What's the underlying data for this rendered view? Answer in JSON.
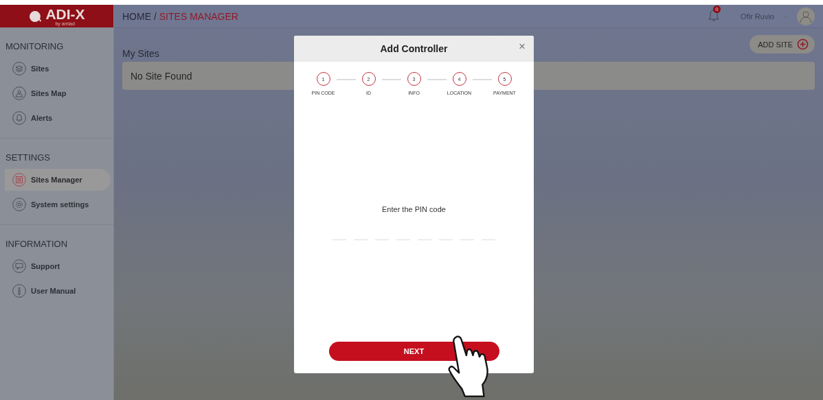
{
  "logo": {
    "name": "ADI-X",
    "tagline": "by amiad"
  },
  "breadcrumb": {
    "home": "HOME /",
    "current": "SITES MANAGER"
  },
  "header": {
    "notifications": "0",
    "user": "Ofir Ruvio"
  },
  "sidebar": {
    "sections": [
      {
        "title": "MONITORING",
        "items": [
          {
            "label": "Sites",
            "kind": "layers",
            "selected": false
          },
          {
            "label": "Sites Map",
            "kind": "map",
            "selected": false
          },
          {
            "label": "Alerts",
            "kind": "bell",
            "selected": false
          }
        ]
      },
      {
        "title": "SETTINGS",
        "items": [
          {
            "label": "Sites Manager",
            "kind": "sliders",
            "selected": true
          },
          {
            "label": "System settings",
            "kind": "gear",
            "selected": false
          }
        ]
      },
      {
        "title": "INFORMATION",
        "items": [
          {
            "label": "Support",
            "kind": "chat",
            "selected": false
          },
          {
            "label": "User Manual",
            "kind": "info",
            "selected": false
          }
        ]
      }
    ]
  },
  "main": {
    "title": "My Sites",
    "add_button": "ADD SITE",
    "empty": "No Site Found"
  },
  "dialog": {
    "title": "Add Controller",
    "close": "×",
    "steps": [
      {
        "number": "1",
        "label": "PIN CODE"
      },
      {
        "number": "2",
        "label": "ID"
      },
      {
        "number": "3",
        "label": "INFO"
      },
      {
        "number": "4",
        "label": "LOCATION"
      },
      {
        "number": "5",
        "label": "PAYMENT"
      }
    ],
    "prompt": "Enter the PIN code",
    "pin_slots": [
      {
        "filled": false
      },
      {
        "filled": false
      },
      {
        "filled": false
      },
      {
        "filled": false
      },
      {
        "filled": false
      },
      {
        "filled": false
      },
      {
        "filled": false
      },
      {
        "filled": false
      }
    ],
    "button": "NEXT"
  }
}
